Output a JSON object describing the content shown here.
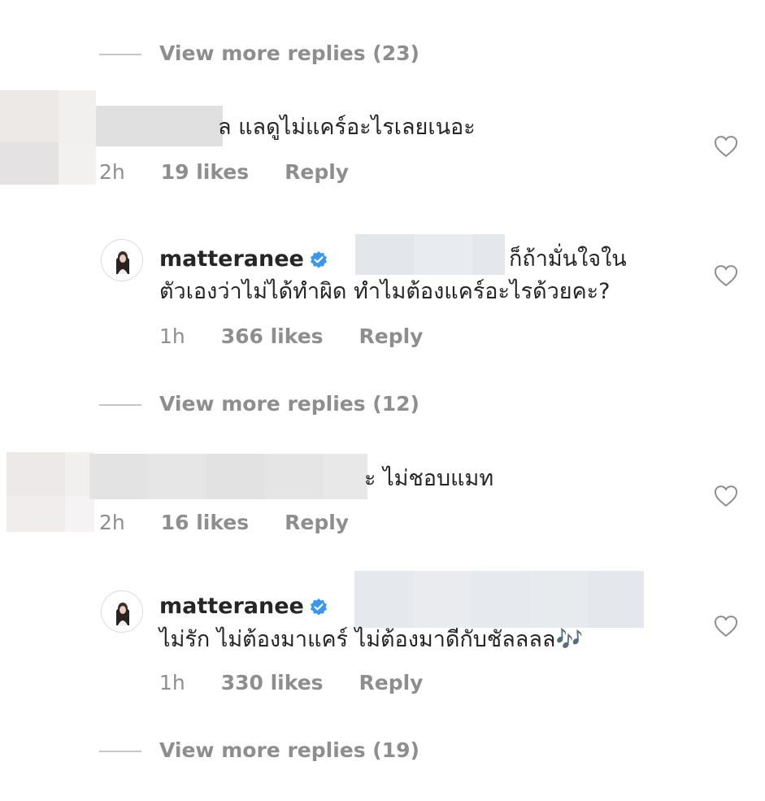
{
  "thread": {
    "view_more_1": "View more replies (23)",
    "comment_1": {
      "text": "ล แลดูไม่แคร์อะไรเลยเนอะ",
      "time": "2h",
      "likes": "19 likes",
      "reply": "Reply"
    },
    "reply_1": {
      "username": "matteranee",
      "text_line1": "ก็ถ้ามั่นใจใน",
      "text_line2": "ตัวเองว่าไม่ได้ทำผิด ทำไมต้องแคร์อะไรด้วยคะ?",
      "time": "1h",
      "likes": "366 likes",
      "reply": "Reply"
    },
    "view_more_2": "View more replies (12)",
    "comment_2": {
      "text": "ะ ไม่ชอบแมท",
      "time": "2h",
      "likes": "16 likes",
      "reply": "Reply"
    },
    "reply_2": {
      "username": "matteranee",
      "text_line1": "ไม่รัก ไม่ต้องมาแคร์ ไม่ต้องมาดีกับชัลลลล",
      "emoji": "🎶",
      "time": "1h",
      "likes": "330 likes",
      "reply": "Reply"
    },
    "view_more_3": "View more replies (19)"
  },
  "colors": {
    "text": "#262626",
    "muted": "#8e8e8e",
    "verified": "#3897f0",
    "redact": "#e6e9ee"
  },
  "icons": {
    "like": "heart-icon",
    "verified": "verified-badge-icon"
  }
}
